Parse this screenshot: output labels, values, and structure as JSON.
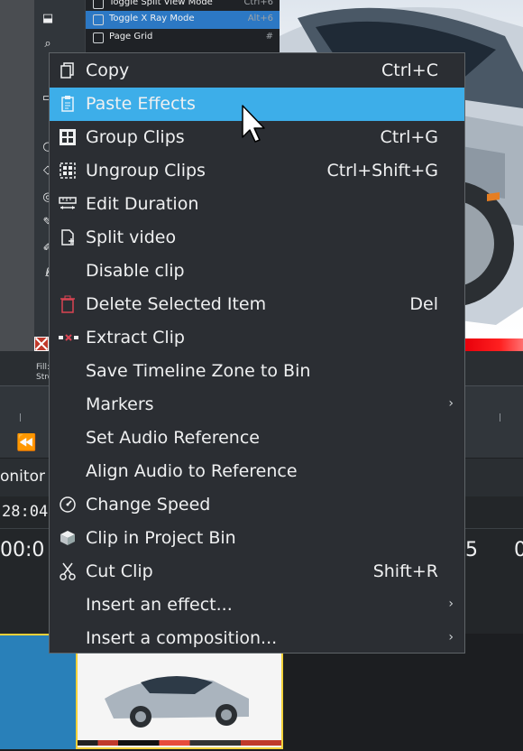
{
  "submenu": {
    "items": [
      {
        "label": "Toggle Split View Mode",
        "shortcut": "Ctrl+6"
      },
      {
        "label": "Toggle X Ray Mode",
        "shortcut": "Alt+6"
      },
      {
        "label": "Page Grid",
        "shortcut": "#"
      }
    ]
  },
  "monitor": {
    "fill_label": "Fill:",
    "stroke_label": "Stro",
    "tab_label": "onitor",
    "timecode": "28:04",
    "ruler_left": "00:0",
    "ruler_mid": "5",
    "ruler_right": "0"
  },
  "context_menu": {
    "items": [
      {
        "label": "Copy",
        "shortcut": "Ctrl+C",
        "icon": "copy-icon"
      },
      {
        "label": "Paste Effects",
        "shortcut": "",
        "icon": "paste-icon"
      },
      {
        "label": "Group Clips",
        "shortcut": "Ctrl+G",
        "icon": "group-icon"
      },
      {
        "label": "Ungroup Clips",
        "shortcut": "Ctrl+Shift+G",
        "icon": "ungroup-icon"
      },
      {
        "label": "Edit Duration",
        "shortcut": "",
        "icon": "ruler-icon"
      },
      {
        "label": "Split video",
        "shortcut": "",
        "icon": "split-icon"
      },
      {
        "label": "Disable clip",
        "shortcut": "",
        "icon": ""
      },
      {
        "label": "Delete Selected Item",
        "shortcut": "Del",
        "icon": "trash-icon"
      },
      {
        "label": "Extract Clip",
        "shortcut": "",
        "icon": "extract-icon"
      },
      {
        "label": "Save Timeline Zone to Bin",
        "shortcut": "",
        "icon": ""
      },
      {
        "label": "Markers",
        "shortcut": "",
        "icon": "",
        "submenu": true
      },
      {
        "label": "Set Audio Reference",
        "shortcut": "",
        "icon": ""
      },
      {
        "label": "Align Audio to Reference",
        "shortcut": "",
        "icon": ""
      },
      {
        "label": "Change Speed",
        "shortcut": "",
        "icon": "speed-icon"
      },
      {
        "label": "Clip in Project Bin",
        "shortcut": "",
        "icon": "bin-icon"
      },
      {
        "label": "Cut Clip",
        "shortcut": "Shift+R",
        "icon": "scissors-icon"
      },
      {
        "label": "Insert an effect...",
        "shortcut": "",
        "icon": "",
        "submenu": true
      },
      {
        "label": "Insert a composition...",
        "shortcut": "",
        "icon": "",
        "submenu": true
      }
    ],
    "highlight_color": "#3daee9"
  }
}
